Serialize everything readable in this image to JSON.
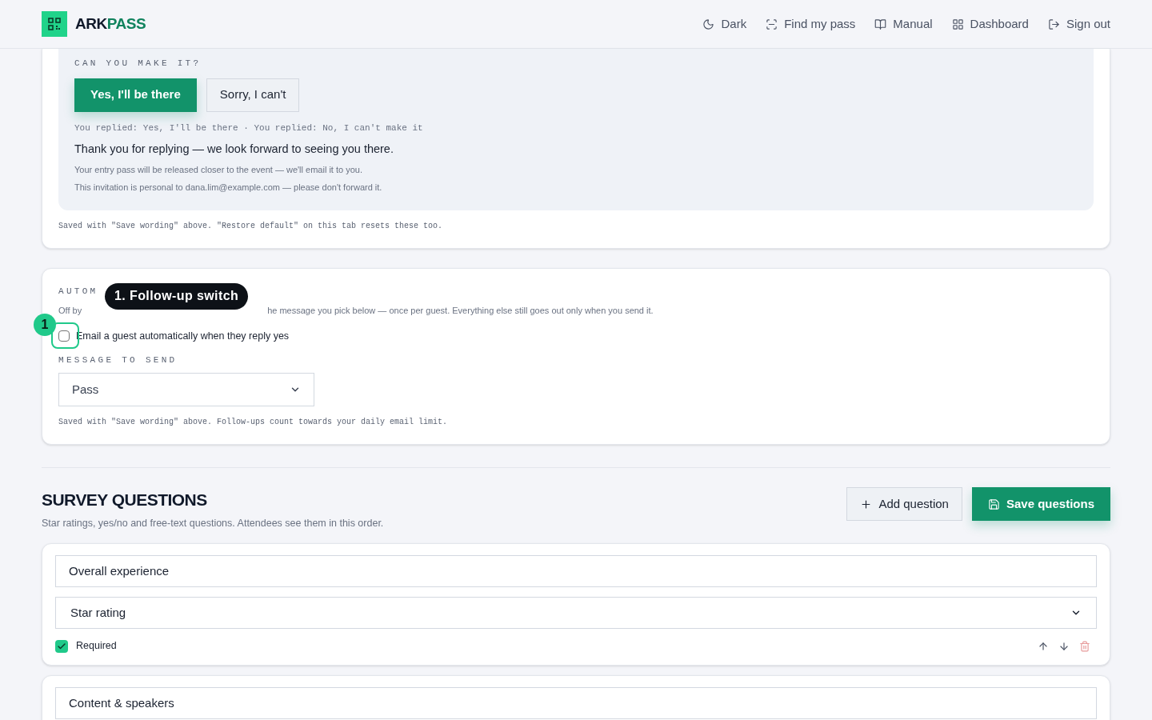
{
  "header": {
    "brand_first": "ARK",
    "brand_second": "PASS",
    "nav": [
      {
        "kind": "moon",
        "label": "Dark"
      },
      {
        "kind": "scan",
        "label": "Find my pass"
      },
      {
        "kind": "book",
        "label": "Manual"
      },
      {
        "kind": "grid",
        "label": "Dashboard"
      },
      {
        "kind": "signout",
        "label": "Sign out"
      }
    ]
  },
  "rsvp_card": {
    "label": "CAN YOU MAKE IT?",
    "buttons": [
      {
        "label": "Yes, I'll be there",
        "selected": true
      },
      {
        "label": "Sorry, I can't",
        "selected": false
      }
    ],
    "replied_note": "You replied: Yes, I'll be there · You replied: No, I can't make it",
    "thanks": "Thank you for replying — we look forward to seeing you there.",
    "lines": [
      "Your entry pass will be released closer to the event — we'll email it to you.",
      "This invitation is personal to dana.lim@example.com — please don't forward it."
    ],
    "footnote": "Saved with \"Save wording\" above. \"Restore default\" on this tab resets these too."
  },
  "followup_card": {
    "label": "AUTOM",
    "description_start": "Off by",
    "description_end": "he message you pick below — once per guest. Everything else still goes out only when you send it.",
    "checkbox": {
      "label": "Email a guest automatically when they reply yes",
      "checked": false
    },
    "message_label": "MESSAGE TO SEND",
    "message_value": "Pass",
    "footnote": "Saved with \"Save wording\" above. Follow-ups count towards your daily email limit."
  },
  "annotation": {
    "badge": "1",
    "tooltip": "1. Follow-up switch"
  },
  "survey": {
    "title": "SURVEY QUESTIONS",
    "subtitle": "Star ratings, yes/no and free-text questions. Attendees see them in this order.",
    "add_button": "Add question",
    "save_button": "Save questions",
    "questions": [
      {
        "title": "Overall experience",
        "type": "Star rating",
        "required_label": "Required",
        "required": true
      },
      {
        "title": "Content & speakers"
      }
    ]
  }
}
